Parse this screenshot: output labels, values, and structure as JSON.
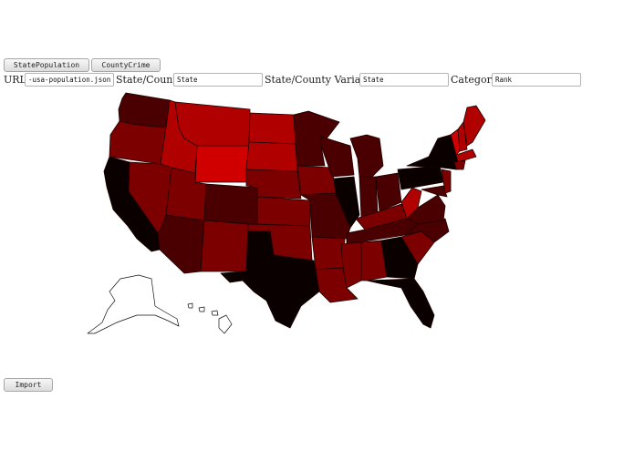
{
  "toolbar": {
    "state_population_label": "StatePopulation",
    "county_crime_label": "CountyCrime"
  },
  "form": {
    "url_label": "URL:",
    "url_value": "-usa-population.json",
    "state_county_label": "State/County:",
    "state_county_value": "State",
    "variable_label": "State/County Variable:",
    "variable_value": "State",
    "category_label": "Category:",
    "category_value": "Rank"
  },
  "footer": {
    "import_label": "Import"
  },
  "colors": {
    "darkest": "#0a0000",
    "dark": "#4a0000",
    "medium": "#7c0000",
    "bright": "#b00000",
    "brightest": "#d00000"
  }
}
